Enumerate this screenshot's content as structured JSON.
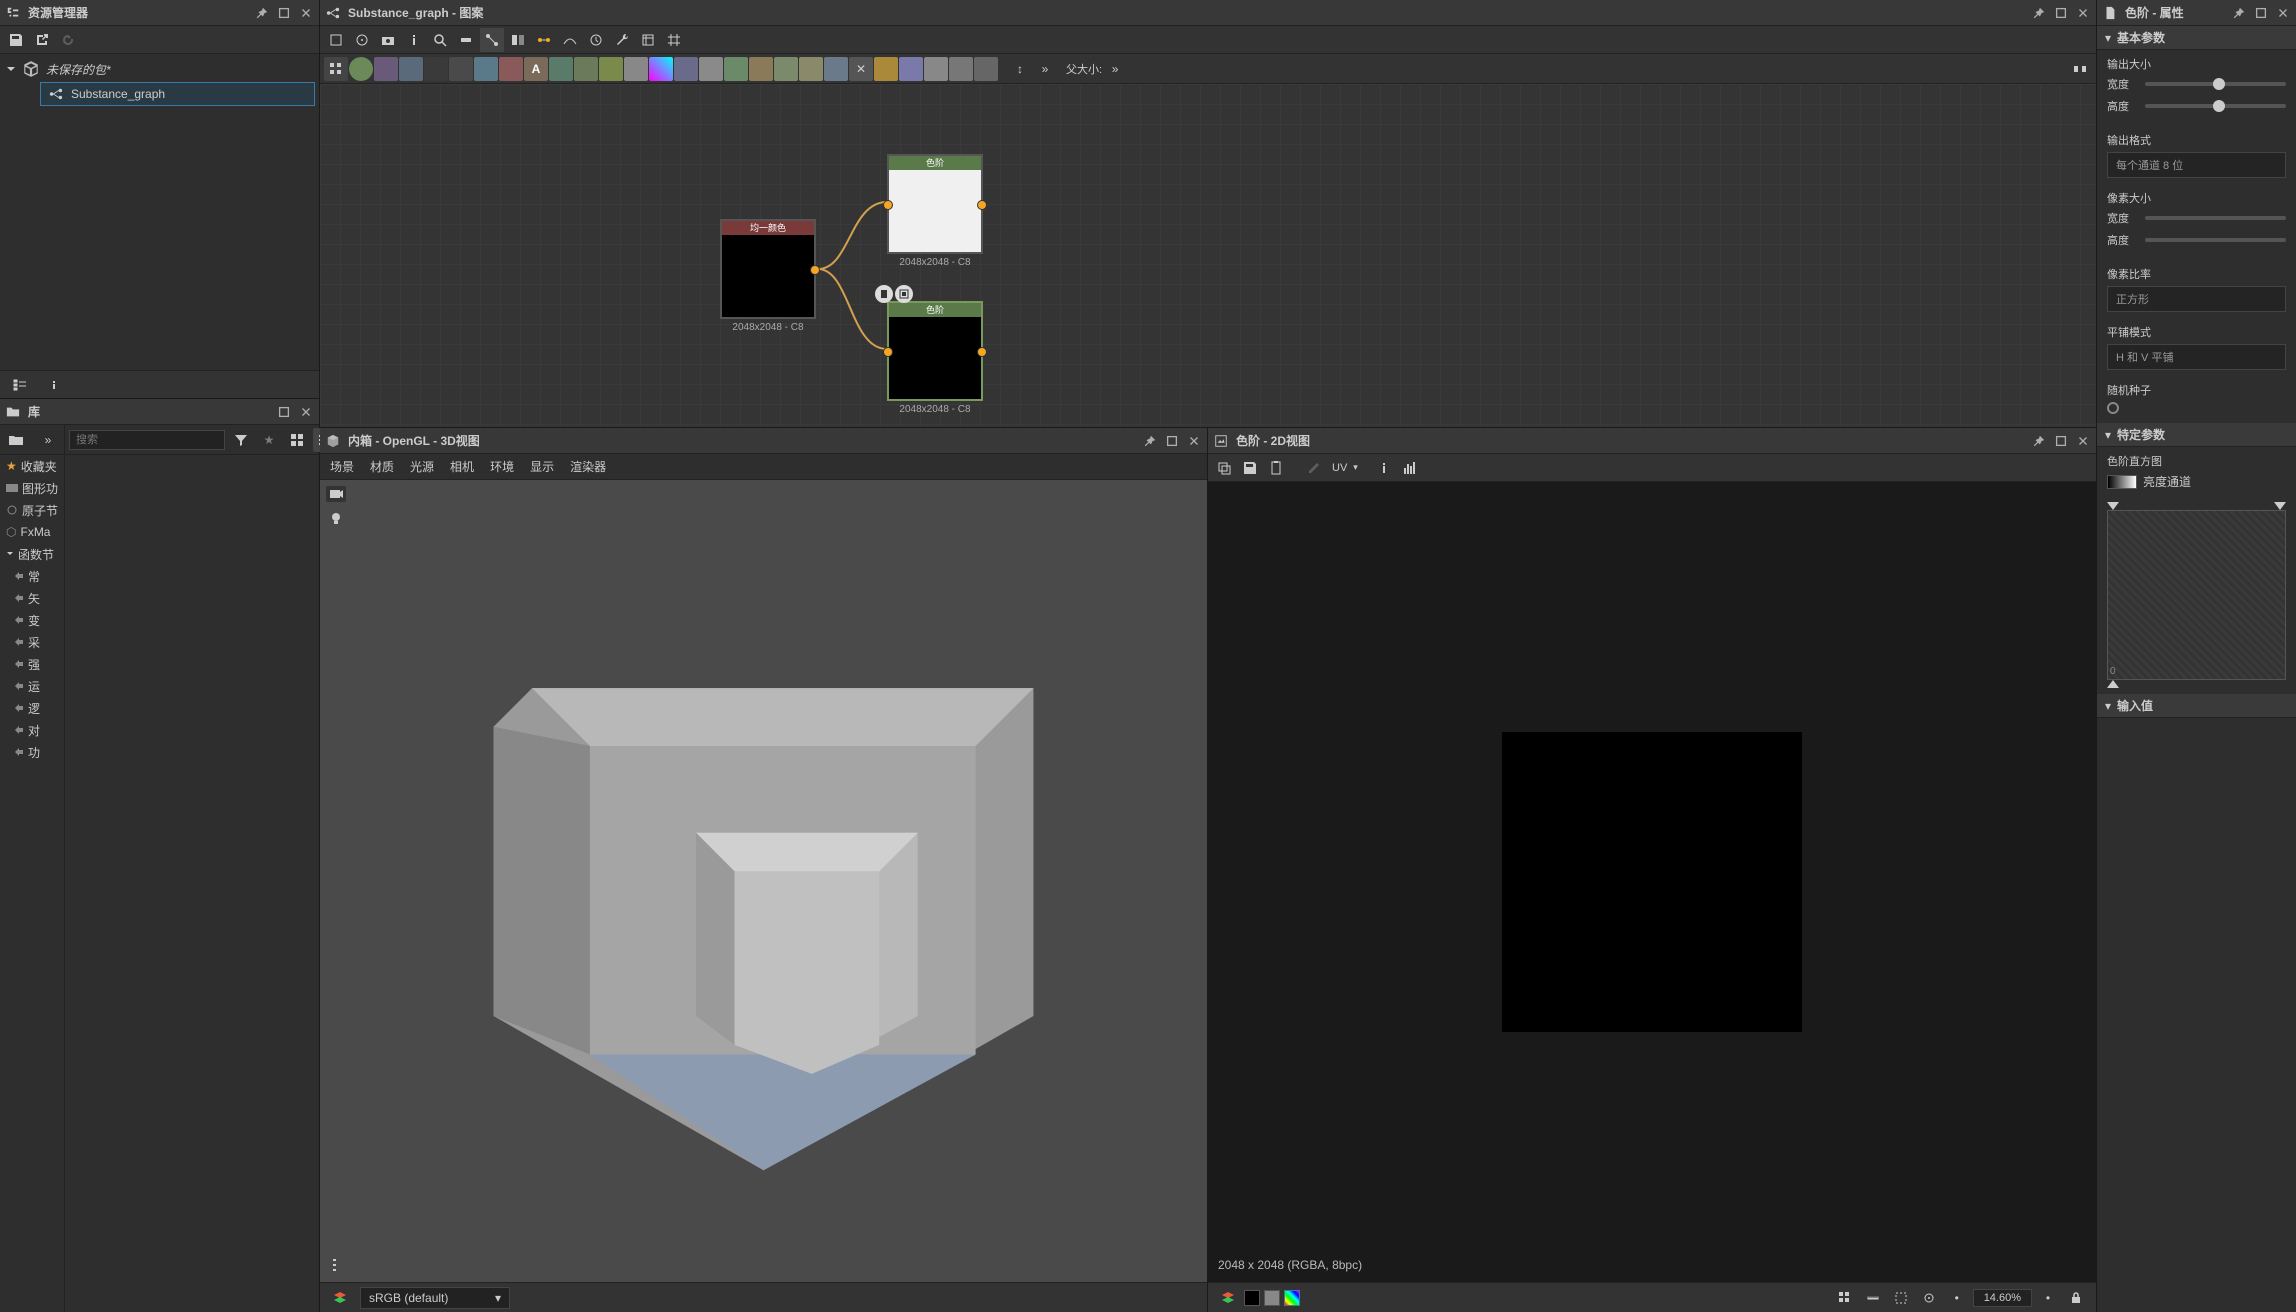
{
  "explorer": {
    "title": "资源管理器",
    "package": "未保存的包*",
    "graph_item": "Substance_graph"
  },
  "library": {
    "title": "库",
    "search_placeholder": "搜索",
    "categories": [
      "收藏夹",
      "图形功",
      "原子节",
      "FxMa"
    ],
    "fn_header": "函数节",
    "fn_items": [
      "常",
      "矢",
      "变",
      "采",
      "强",
      "运",
      "逻",
      "对",
      "功"
    ]
  },
  "graph": {
    "title": "Substance_graph - 图案",
    "parent_label": "父大小:",
    "node1": {
      "label": "均一颜色",
      "info": "2048x2048 - C8"
    },
    "node2": {
      "label": "色阶",
      "info": "2048x2048 - C8"
    },
    "node3": {
      "label": "色阶",
      "info": "2048x2048 - C8"
    }
  },
  "view3d": {
    "title": "内箱 - OpenGL - 3D视图",
    "menu": [
      "场景",
      "材质",
      "光源",
      "相机",
      "环境",
      "显示",
      "渲染器"
    ],
    "colorspace": "sRGB (default)"
  },
  "view2d": {
    "title": "色阶 - 2D视图",
    "uv_label": "UV",
    "info": "2048 x 2048 (RGBA, 8bpc)",
    "zoom": "14.60%"
  },
  "props": {
    "title": "色阶 - 属性",
    "sections": {
      "basic": "基本参数",
      "specific": "特定参数",
      "input": "输入值"
    },
    "output_size": "输出大小",
    "width": "宽度",
    "height": "高度",
    "output_format": "输出格式",
    "format_value": "每个通道 8 位",
    "pixel_size": "像素大小",
    "pixel_ratio": "像素比率",
    "ratio_value": "正方形",
    "tiling": "平铺模式",
    "tiling_value": "H 和 V 平铺",
    "seed": "随机种子",
    "histo": "色阶直方图",
    "histo_channel": "亮度通道",
    "histo_zero": "0"
  }
}
